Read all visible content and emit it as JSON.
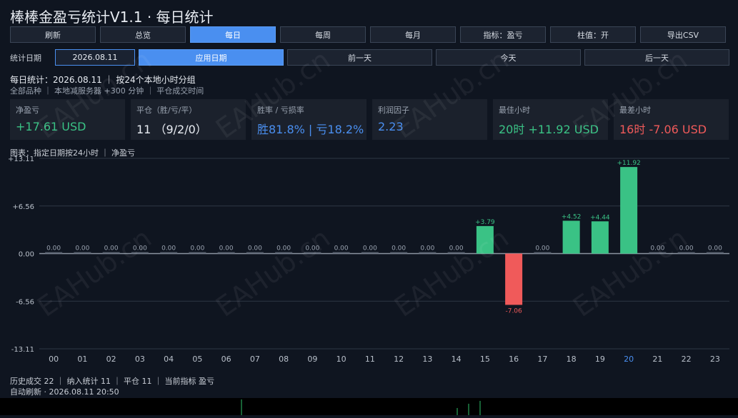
{
  "window": {
    "title": "棒棒金盈亏统计V1.1 · 每日统计"
  },
  "toolbar": {
    "buttons": [
      "刷新",
      "总览",
      "每日",
      "每周",
      "每月",
      "指标：盈亏",
      "柱值：开",
      "导出CSV"
    ],
    "active_index": 2
  },
  "date_bar": {
    "label": "统计日期",
    "date_value": "2026.08.11",
    "apply_label": "应用日期",
    "prev_label": "前一天",
    "today_label": "今天",
    "next_label": "后一天"
  },
  "summary": {
    "line1": "每日统计：2026.08.11  ｜  按24个本地小时分组",
    "line2": "全部品种  ｜  本地减服务器 +300 分钟  ｜  平仓成交时间"
  },
  "cards": [
    {
      "label": "净盈亏",
      "value": "+17.61 USD",
      "color": "#3ac285"
    },
    {
      "label": "平仓（胜/亏/平）",
      "value": "11 （9/2/0）",
      "color": "#e8ecf2"
    },
    {
      "label": "胜率 / 亏损率",
      "value": "胜81.8% | 亏18.2%",
      "color": "#4a8ff0"
    },
    {
      "label": "利润因子",
      "value": "2.23",
      "color": "#4a8ff0"
    },
    {
      "label": "最佳小时",
      "value": "20时 +11.92 USD",
      "color": "#3ac285"
    },
    {
      "label": "最差小时",
      "value": "16时 -7.06 USD",
      "color": "#f05a5a"
    }
  ],
  "chart_title": "图表：指定日期按24小时  ｜  净盈亏",
  "chart_data": {
    "type": "bar",
    "categories": [
      "00",
      "01",
      "02",
      "03",
      "04",
      "05",
      "06",
      "07",
      "08",
      "09",
      "10",
      "11",
      "12",
      "13",
      "14",
      "15",
      "16",
      "17",
      "18",
      "19",
      "20",
      "21",
      "22",
      "23"
    ],
    "values": [
      0,
      0,
      0,
      0,
      0,
      0,
      0,
      0,
      0,
      0,
      0,
      0,
      0,
      0,
      0,
      3.79,
      -7.06,
      0,
      4.52,
      4.44,
      11.92,
      0,
      0,
      0
    ],
    "data_labels": [
      "0.00",
      "0.00",
      "0.00",
      "0.00",
      "0.00",
      "0.00",
      "0.00",
      "0.00",
      "0.00",
      "0.00",
      "0.00",
      "0.00",
      "0.00",
      "0.00",
      "0.00",
      "+3.79",
      "-7.06",
      "0.00",
      "+4.52",
      "+4.44",
      "+11.92",
      "0.00",
      "0.00",
      "0.00"
    ],
    "y_ticks": [
      "+13.11",
      "+6.56",
      "0.00",
      "-6.56",
      "-13.11"
    ],
    "ylim": [
      -13.11,
      13.11
    ],
    "highlight_category": "20",
    "positive_color": "#3ac285",
    "negative_color": "#f05a5a"
  },
  "footer": {
    "line1": "历史成交 22  ｜  纳入统计 11  ｜  平仓 11  ｜  当前指标 盈亏",
    "line2": "自动刷新 · 2026.08.11 20:50"
  },
  "watermark": "EAHub.cn"
}
